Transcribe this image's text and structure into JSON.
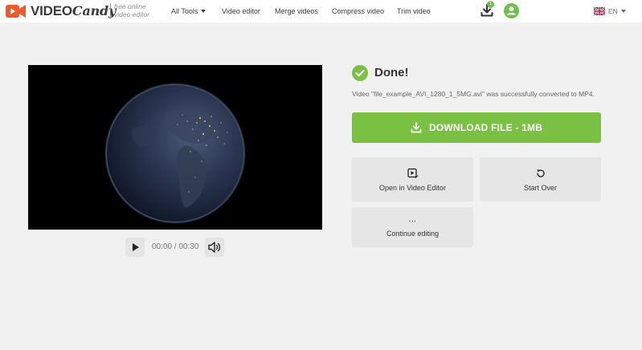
{
  "header": {
    "logo": {
      "word1": "VIDEO",
      "word2": "Candy",
      "tagline_line1": "free online",
      "tagline_line2": "video editor"
    },
    "nav": [
      {
        "label": "All Tools",
        "has_dropdown": true
      },
      {
        "label": "Video editor"
      },
      {
        "label": "Merge videos"
      },
      {
        "label": "Compress video"
      },
      {
        "label": "Trim video"
      }
    ],
    "downloads_badge": "1",
    "language": "EN"
  },
  "player": {
    "time": "00:00 / 00:30"
  },
  "result": {
    "title": "Done!",
    "message": "Video \"file_example_AVI_1280_1_5MG.avi\" was successfully converted to MP4.",
    "download_label": "DOWNLOAD FILE - 1MB",
    "open_editor_label": "Open in Video Editor",
    "start_over_label": "Start Over",
    "continue_dots": "...",
    "continue_label": "Continue editing"
  },
  "icons": {
    "logo": "camera-play-icon",
    "downloads": "download-tray-icon",
    "account": "user-avatar-icon",
    "language": "uk-flag-icon",
    "done": "check-circle-icon",
    "download_button": "download-icon",
    "open_editor": "video-edit-icon",
    "start_over": "restart-icon",
    "play": "play-icon",
    "volume": "volume-icon"
  },
  "colors": {
    "accent_green": "#7ac143",
    "logo_orange": "#ef5a2a",
    "page_background": "#f1f1f1",
    "card_background": "#e6e6e6"
  }
}
